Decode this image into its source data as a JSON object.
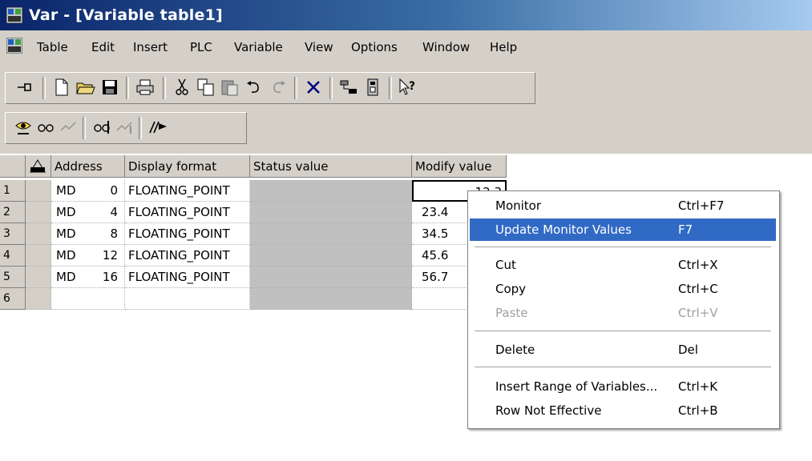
{
  "window": {
    "title": "Var - [Variable table1]"
  },
  "menubar": {
    "items": [
      "Table",
      "Edit",
      "Insert",
      "PLC",
      "Variable",
      "View",
      "Options",
      "Window",
      "Help"
    ]
  },
  "toolbar1": {
    "icons": [
      "pin-icon",
      "new-file-icon",
      "open-folder-icon",
      "save-icon",
      "print-icon",
      "cut-icon",
      "copy-icon",
      "paste-icon",
      "undo-icon",
      "redo-icon",
      "delete-icon",
      "online-icon",
      "accessible-nodes-icon",
      "context-help-icon"
    ]
  },
  "toolbar2": {
    "icons": [
      "monitor-variable-icon",
      "monitor-glasses-icon",
      "trigger-icon",
      "modify-glasses-icon",
      "modify-trigger-icon",
      "force-icon"
    ]
  },
  "table": {
    "columns": [
      "Address",
      "Display format",
      "Status value",
      "Modify value"
    ],
    "rows": [
      {
        "num": "1",
        "op": "MD",
        "addr": "0",
        "fmt": "FLOATING_POINT",
        "status": "",
        "modify": "12.3"
      },
      {
        "num": "2",
        "op": "MD",
        "addr": "4",
        "fmt": "FLOATING_POINT",
        "status": "",
        "modify": "23.4"
      },
      {
        "num": "3",
        "op": "MD",
        "addr": "8",
        "fmt": "FLOATING_POINT",
        "status": "",
        "modify": "34.5"
      },
      {
        "num": "4",
        "op": "MD",
        "addr": "12",
        "fmt": "FLOATING_POINT",
        "status": "",
        "modify": "45.6"
      },
      {
        "num": "5",
        "op": "MD",
        "addr": "16",
        "fmt": "FLOATING_POINT",
        "status": "",
        "modify": "56.7"
      },
      {
        "num": "6",
        "op": "",
        "addr": "",
        "fmt": "",
        "status": "",
        "modify": ""
      }
    ]
  },
  "context_menu": {
    "items": [
      {
        "label": "Monitor",
        "shortcut": "Ctrl+F7"
      },
      {
        "label": "Update Monitor Values",
        "shortcut": "F7",
        "highlighted": true
      },
      {
        "label": "Cut",
        "shortcut": "Ctrl+X"
      },
      {
        "label": "Copy",
        "shortcut": "Ctrl+C"
      },
      {
        "label": "Paste",
        "shortcut": "Ctrl+V",
        "disabled": true
      },
      {
        "label": "Delete",
        "shortcut": "Del"
      },
      {
        "label": "Insert Range of Variables...",
        "shortcut": "Ctrl+K"
      },
      {
        "label": "Row Not Effective",
        "shortcut": "Ctrl+B"
      }
    ]
  },
  "colors": {
    "title_gradient_start": "#0a246a",
    "title_gradient_end": "#a6caf0",
    "chrome": "#d4d0c8",
    "highlight": "#316ac5",
    "status_cell": "#c0c0c0"
  }
}
